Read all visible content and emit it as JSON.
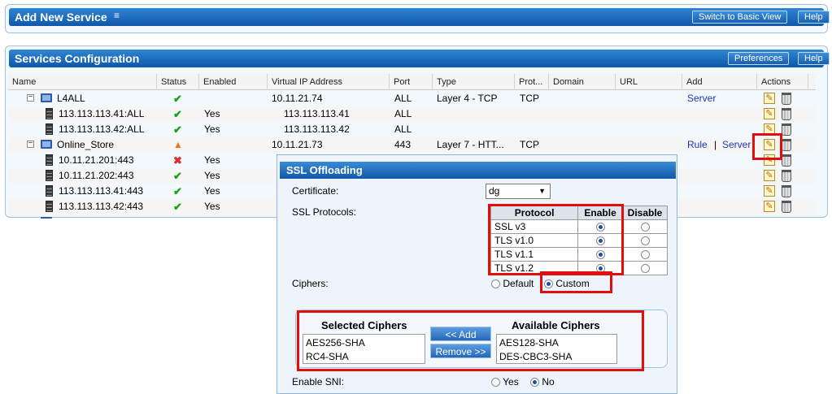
{
  "add_panel": {
    "title": "Add New Service",
    "switch_label": "Switch to Basic View",
    "help_label": "Help"
  },
  "services_panel": {
    "title": "Services Configuration",
    "preferences_label": "Preferences",
    "help_label": "Help"
  },
  "columns": [
    "Name",
    "Status",
    "Enabled",
    "Virtual IP Address",
    "Port",
    "Type",
    "Prot...",
    "Domain",
    "URL",
    "Add",
    "Actions"
  ],
  "rows": [
    {
      "name": "L4ALL",
      "kind": "service",
      "status": "ok",
      "enabled": "",
      "vip": "10.11.21.74",
      "port": "ALL",
      "type": "Layer 4 - TCP",
      "proto": "TCP",
      "add_links": [
        "Server"
      ]
    },
    {
      "name": "113.113.113.41:ALL",
      "kind": "server",
      "status": "ok",
      "enabled": "Yes",
      "vip": "113.113.113.41",
      "port": "ALL",
      "type": "",
      "proto": "",
      "add_links": []
    },
    {
      "name": "113.113.113.42:ALL",
      "kind": "server",
      "status": "ok",
      "enabled": "Yes",
      "vip": "113.113.113.42",
      "port": "ALL",
      "type": "",
      "proto": "",
      "add_links": []
    },
    {
      "name": "Online_Store",
      "kind": "service",
      "status": "warning",
      "enabled": "",
      "vip": "10.11.21.73",
      "port": "443",
      "type": "Layer 7 - HTT...",
      "proto": "TCP",
      "add_links": [
        "Rule",
        "Server"
      ]
    },
    {
      "name": "10.11.21.201:443",
      "kind": "server",
      "status": "error",
      "enabled": "Yes",
      "vip": "",
      "port": "",
      "type": "",
      "proto": "",
      "add_links": []
    },
    {
      "name": "10.11.21.202:443",
      "kind": "server",
      "status": "ok",
      "enabled": "Yes",
      "vip": "",
      "port": "",
      "type": "",
      "proto": "",
      "add_links": []
    },
    {
      "name": "113.113.113.41:443",
      "kind": "server",
      "status": "ok",
      "enabled": "Yes",
      "vip": "",
      "port": "",
      "type": "",
      "proto": "",
      "add_links": []
    },
    {
      "name": "113.113.113.42:443",
      "kind": "server",
      "status": "ok",
      "enabled": "Yes",
      "vip": "",
      "port": "",
      "type": "",
      "proto": "",
      "add_links": []
    }
  ],
  "add_link_separator": "|",
  "ssl": {
    "title": "SSL Offloading",
    "certificate_label": "Certificate:",
    "certificate_value": "dg",
    "protocols_label": "SSL Protocols:",
    "protocol_header": "Protocol",
    "enable_header": "Enable",
    "disable_header": "Disable",
    "protocols": [
      {
        "name": "SSL v3",
        "enabled": true
      },
      {
        "name": "TLS v1.0",
        "enabled": true
      },
      {
        "name": "TLS v1.1",
        "enabled": true
      },
      {
        "name": "TLS v1.2",
        "enabled": true
      }
    ],
    "ciphers_label": "Ciphers:",
    "ciphers_default": "Default",
    "ciphers_custom": "Custom",
    "ciphers_mode": "Custom",
    "selected_title": "Selected Ciphers",
    "selected_ciphers": [
      "AES256-SHA",
      "RC4-SHA"
    ],
    "available_title": "Available Ciphers",
    "available_ciphers": [
      "AES128-SHA",
      "DES-CBC3-SHA"
    ],
    "add_button": "<< Add",
    "remove_button": "Remove >>",
    "sni_label": "Enable SNI:",
    "sni_yes": "Yes",
    "sni_no": "No",
    "sni_value": "No"
  },
  "colors": {
    "header_blue": "#0f57a9",
    "highlight_red": "#e20d0d",
    "status_ok": "#17a317",
    "status_error": "#d83030",
    "status_warning": "#e87813",
    "link_blue": "#1e36b3"
  },
  "icons": {
    "status_ok": "check-icon",
    "status_error": "cross-icon",
    "status_warning": "warning-icon",
    "service": "monitor-icon",
    "server": "server-icon",
    "edit": "edit-icon",
    "delete": "trash-icon",
    "collapse": "collapse-icon",
    "add_panel_toggle": "chevron-double-down-icon"
  }
}
